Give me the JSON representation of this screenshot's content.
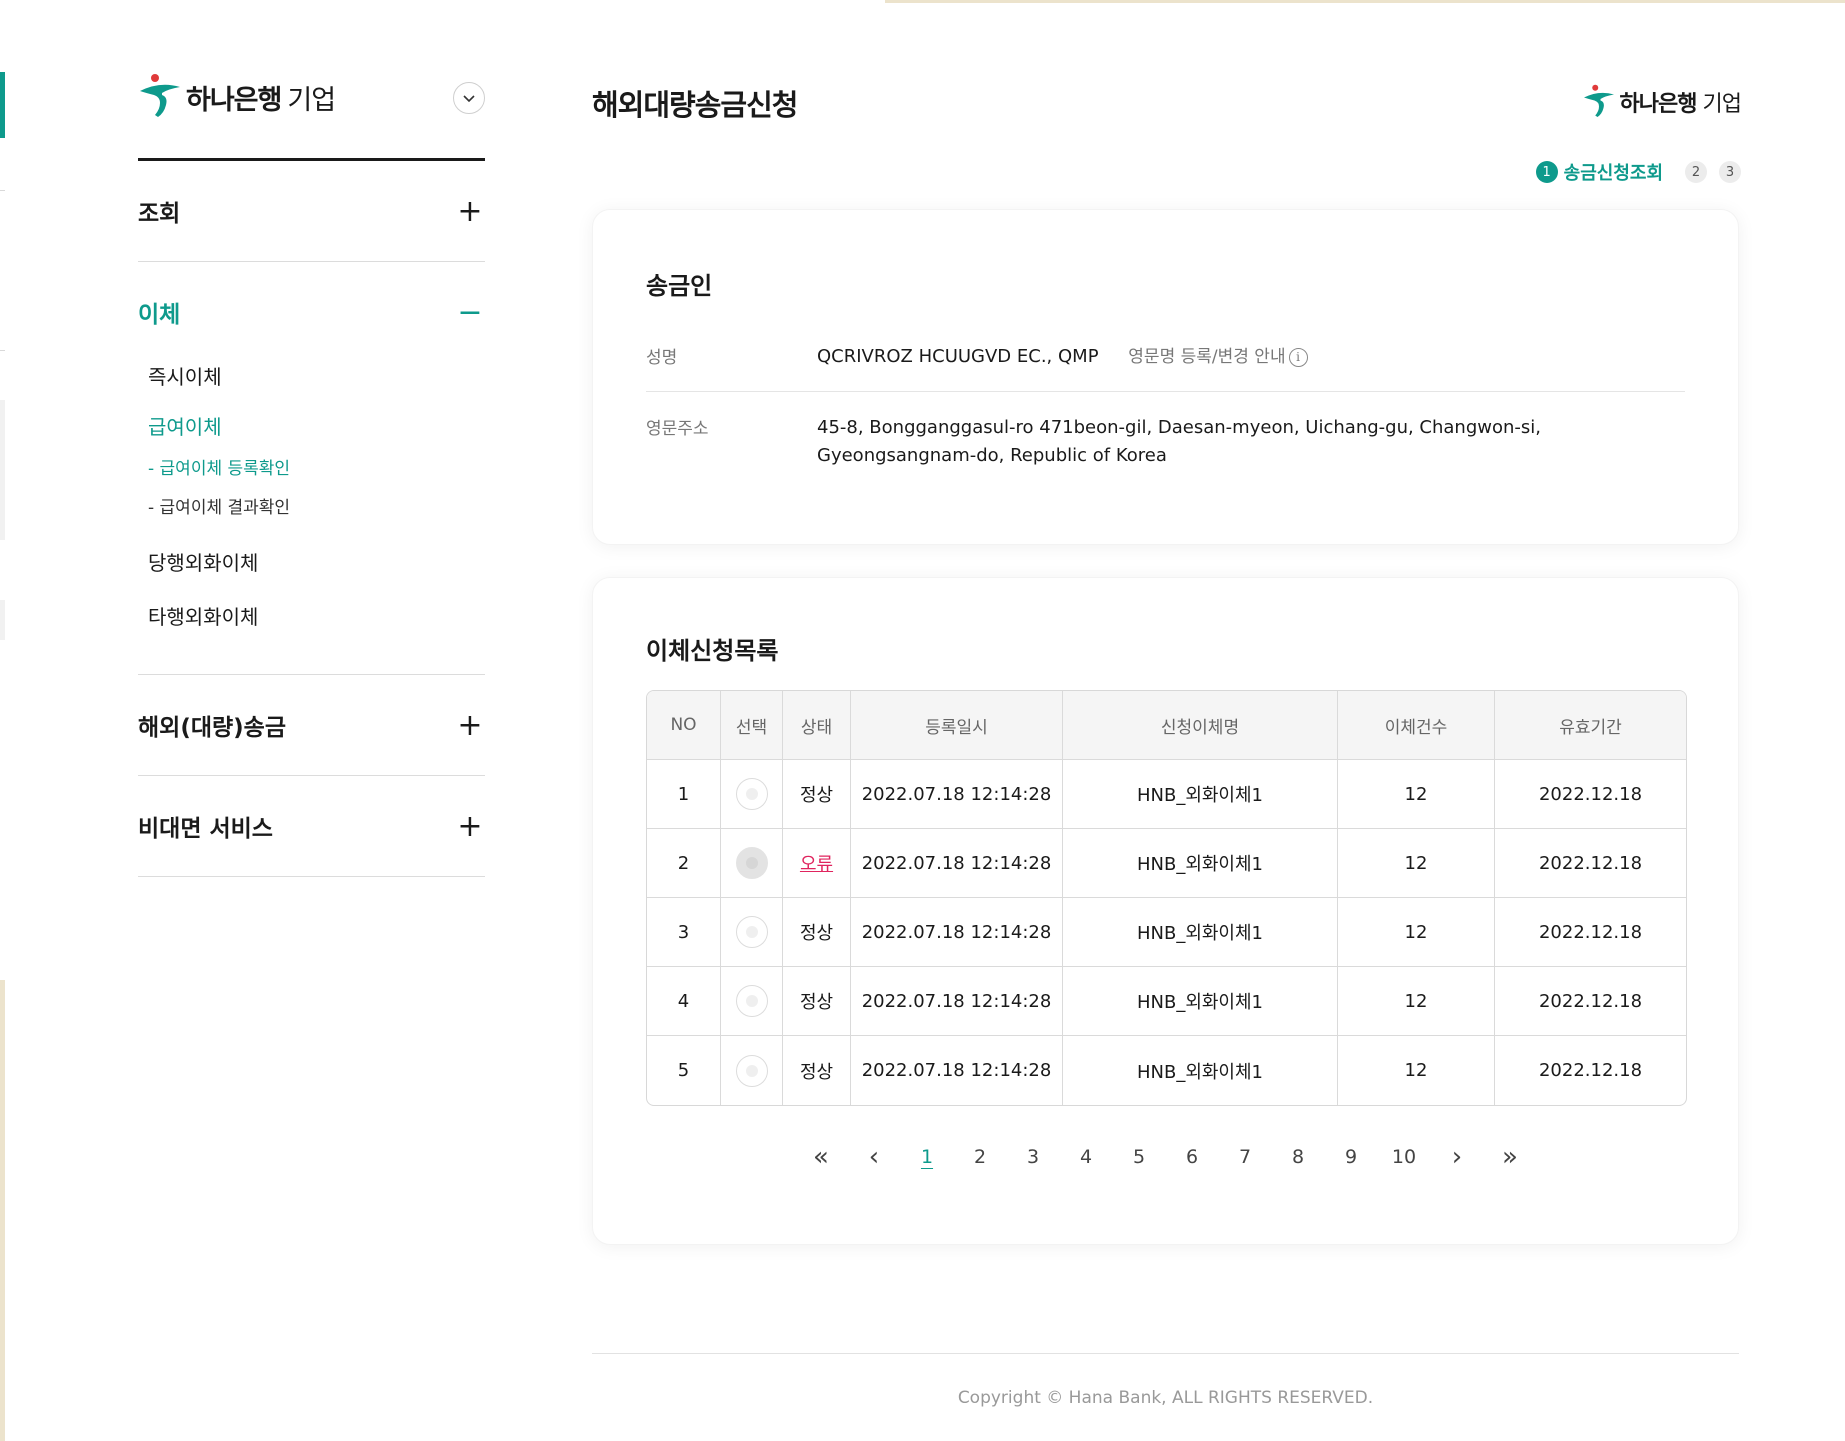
{
  "brand": {
    "name_bold": "하나은행",
    "name_light": "기업",
    "color_primary": "#0e9a8c",
    "color_error": "#e0245e"
  },
  "sidebar": {
    "sections": [
      {
        "label": "조회",
        "sign": "+"
      },
      {
        "label": "이체",
        "sign": "−"
      },
      {
        "label": "해외(대량)송금",
        "sign": "+"
      },
      {
        "label": "비대면 서비스",
        "sign": "+"
      }
    ],
    "transfer_items": [
      {
        "label": "즉시이체"
      },
      {
        "label": "급여이체"
      },
      {
        "label": "- 급여이체 등록확인"
      },
      {
        "label": "- 급여이체 결과확인"
      },
      {
        "label": "당행외화이체"
      },
      {
        "label": "타행외화이체"
      }
    ]
  },
  "page": {
    "title": "해외대량송금신청",
    "steps": {
      "current": "1",
      "current_label": "송금신청조회",
      "others": [
        "2",
        "3"
      ]
    }
  },
  "sender": {
    "section_title": "송금인",
    "name_label": "성명",
    "name_value": "QCRIVROZ HCUUGVD EC., QMP",
    "name_note": "영문명 등록/변경 안내",
    "info_icon": "i",
    "address_label": "영문주소",
    "address_line1": "45-8, Bongganggasul-ro 471beon-gil, Daesan-myeon, Uichang-gu, Changwon-si,",
    "address_line2": "Gyeongsangnam-do, Republic of Korea"
  },
  "transfer_list": {
    "section_title": "이체신청목록",
    "columns": [
      "NO",
      "선택",
      "상태",
      "등록일시",
      "신청이체명",
      "이체건수",
      "유효기간"
    ],
    "rows": [
      {
        "no": "1",
        "status": "정상",
        "registered": "2022.07.18 12:14:28",
        "name": "HNB_외화이체1",
        "count": "12",
        "valid": "2022.12.18"
      },
      {
        "no": "2",
        "status": "오류",
        "registered": "2022.07.18 12:14:28",
        "name": "HNB_외화이체1",
        "count": "12",
        "valid": "2022.12.18"
      },
      {
        "no": "3",
        "status": "정상",
        "registered": "2022.07.18 12:14:28",
        "name": "HNB_외화이체1",
        "count": "12",
        "valid": "2022.12.18"
      },
      {
        "no": "4",
        "status": "정상",
        "registered": "2022.07.18 12:14:28",
        "name": "HNB_외화이체1",
        "count": "12",
        "valid": "2022.12.18"
      },
      {
        "no": "5",
        "status": "정상",
        "registered": "2022.07.18 12:14:28",
        "name": "HNB_외화이체1",
        "count": "12",
        "valid": "2022.12.18"
      }
    ]
  },
  "pagination": {
    "first": "«",
    "prev": "‹",
    "pages": [
      "1",
      "2",
      "3",
      "4",
      "5",
      "6",
      "7",
      "8",
      "9",
      "10"
    ],
    "current": "1",
    "next": "›",
    "last": "»"
  },
  "footer": {
    "copyright": "Copyright © Hana Bank, ALL RIGHTS RESERVED."
  }
}
